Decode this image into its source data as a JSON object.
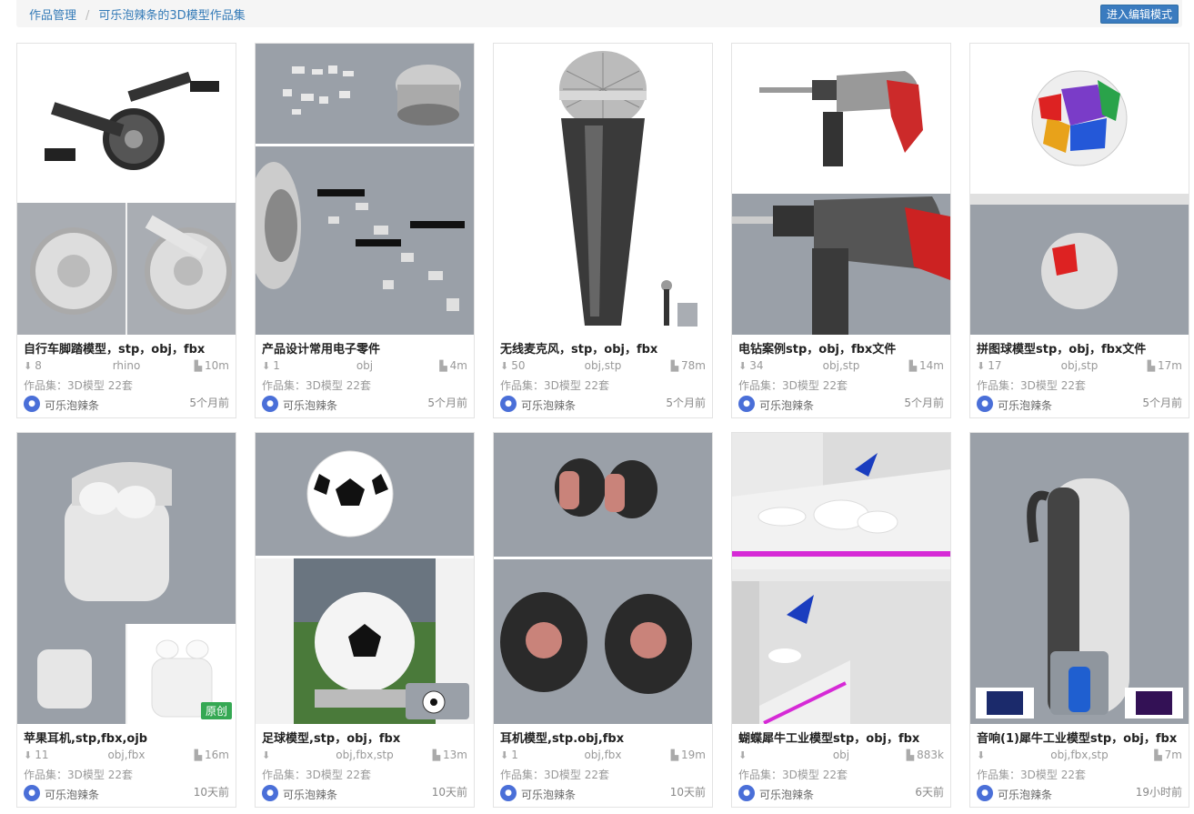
{
  "breadcrumb": {
    "root": "作品管理",
    "current": "可乐泡辣条的3D模型作品集"
  },
  "edit_button": "进入编辑模式",
  "avatar_glyph": "●",
  "cards": [
    {
      "title": "自行车脚踏模型，stp，obj，fbx",
      "downloads": "8",
      "formats": "rhino",
      "size": "10m",
      "collection": "作品集：3D模型 22套",
      "author": "可乐泡辣条",
      "time": "5个月前"
    },
    {
      "title": "产品设计常用电子零件",
      "downloads": "1",
      "formats": "obj",
      "size": "4m",
      "collection": "作品集：3D模型 22套",
      "author": "可乐泡辣条",
      "time": "5个月前"
    },
    {
      "title": "无线麦克风，stp，obj，fbx",
      "downloads": "50",
      "formats": "obj,stp",
      "size": "78m",
      "collection": "作品集：3D模型 22套",
      "author": "可乐泡辣条",
      "time": "5个月前"
    },
    {
      "title": "电钻案例stp，obj，fbx文件",
      "downloads": "34",
      "formats": "obj,stp",
      "size": "14m",
      "collection": "作品集：3D模型 22套",
      "author": "可乐泡辣条",
      "time": "5个月前"
    },
    {
      "title": "拼图球模型stp，obj，fbx文件",
      "downloads": "17",
      "formats": "obj,stp",
      "size": "17m",
      "collection": "作品集：3D模型 22套",
      "author": "可乐泡辣条",
      "time": "5个月前"
    },
    {
      "title": "苹果耳机,stp,fbx,ojb",
      "downloads": "11",
      "formats": "obj,fbx",
      "size": "16m",
      "collection": "作品集：3D模型 22套",
      "author": "可乐泡辣条",
      "time": "10天前",
      "badge": "原创"
    },
    {
      "title": "足球模型,stp，obj，fbx",
      "downloads": "",
      "formats": "obj,fbx,stp",
      "size": "13m",
      "collection": "作品集：3D模型 22套",
      "author": "可乐泡辣条",
      "time": "10天前"
    },
    {
      "title": "耳机模型,stp.obj,fbx",
      "downloads": "1",
      "formats": "obj,fbx",
      "size": "19m",
      "collection": "作品集：3D模型 22套",
      "author": "可乐泡辣条",
      "time": "10天前"
    },
    {
      "title": "蝴蝶犀牛工业模型stp，obj，fbx",
      "downloads": "",
      "formats": "obj",
      "size": "883k",
      "collection": "作品集：3D模型 22套",
      "author": "可乐泡辣条",
      "time": "6天前"
    },
    {
      "title": "音响(1)犀牛工业模型stp，obj，fbx",
      "downloads": "",
      "formats": "obj,fbx,stp",
      "size": "7m",
      "collection": "作品集：3D模型 22套",
      "author": "可乐泡辣条",
      "time": "19小时前"
    }
  ],
  "icons": {
    "download": "download-icon",
    "file": "file-icon",
    "avatar": "avatar-icon"
  },
  "colors": {
    "link": "#337ab7",
    "button": "#3a7bbf",
    "badge": "#35a853",
    "avatar": "#4a6fd8"
  }
}
